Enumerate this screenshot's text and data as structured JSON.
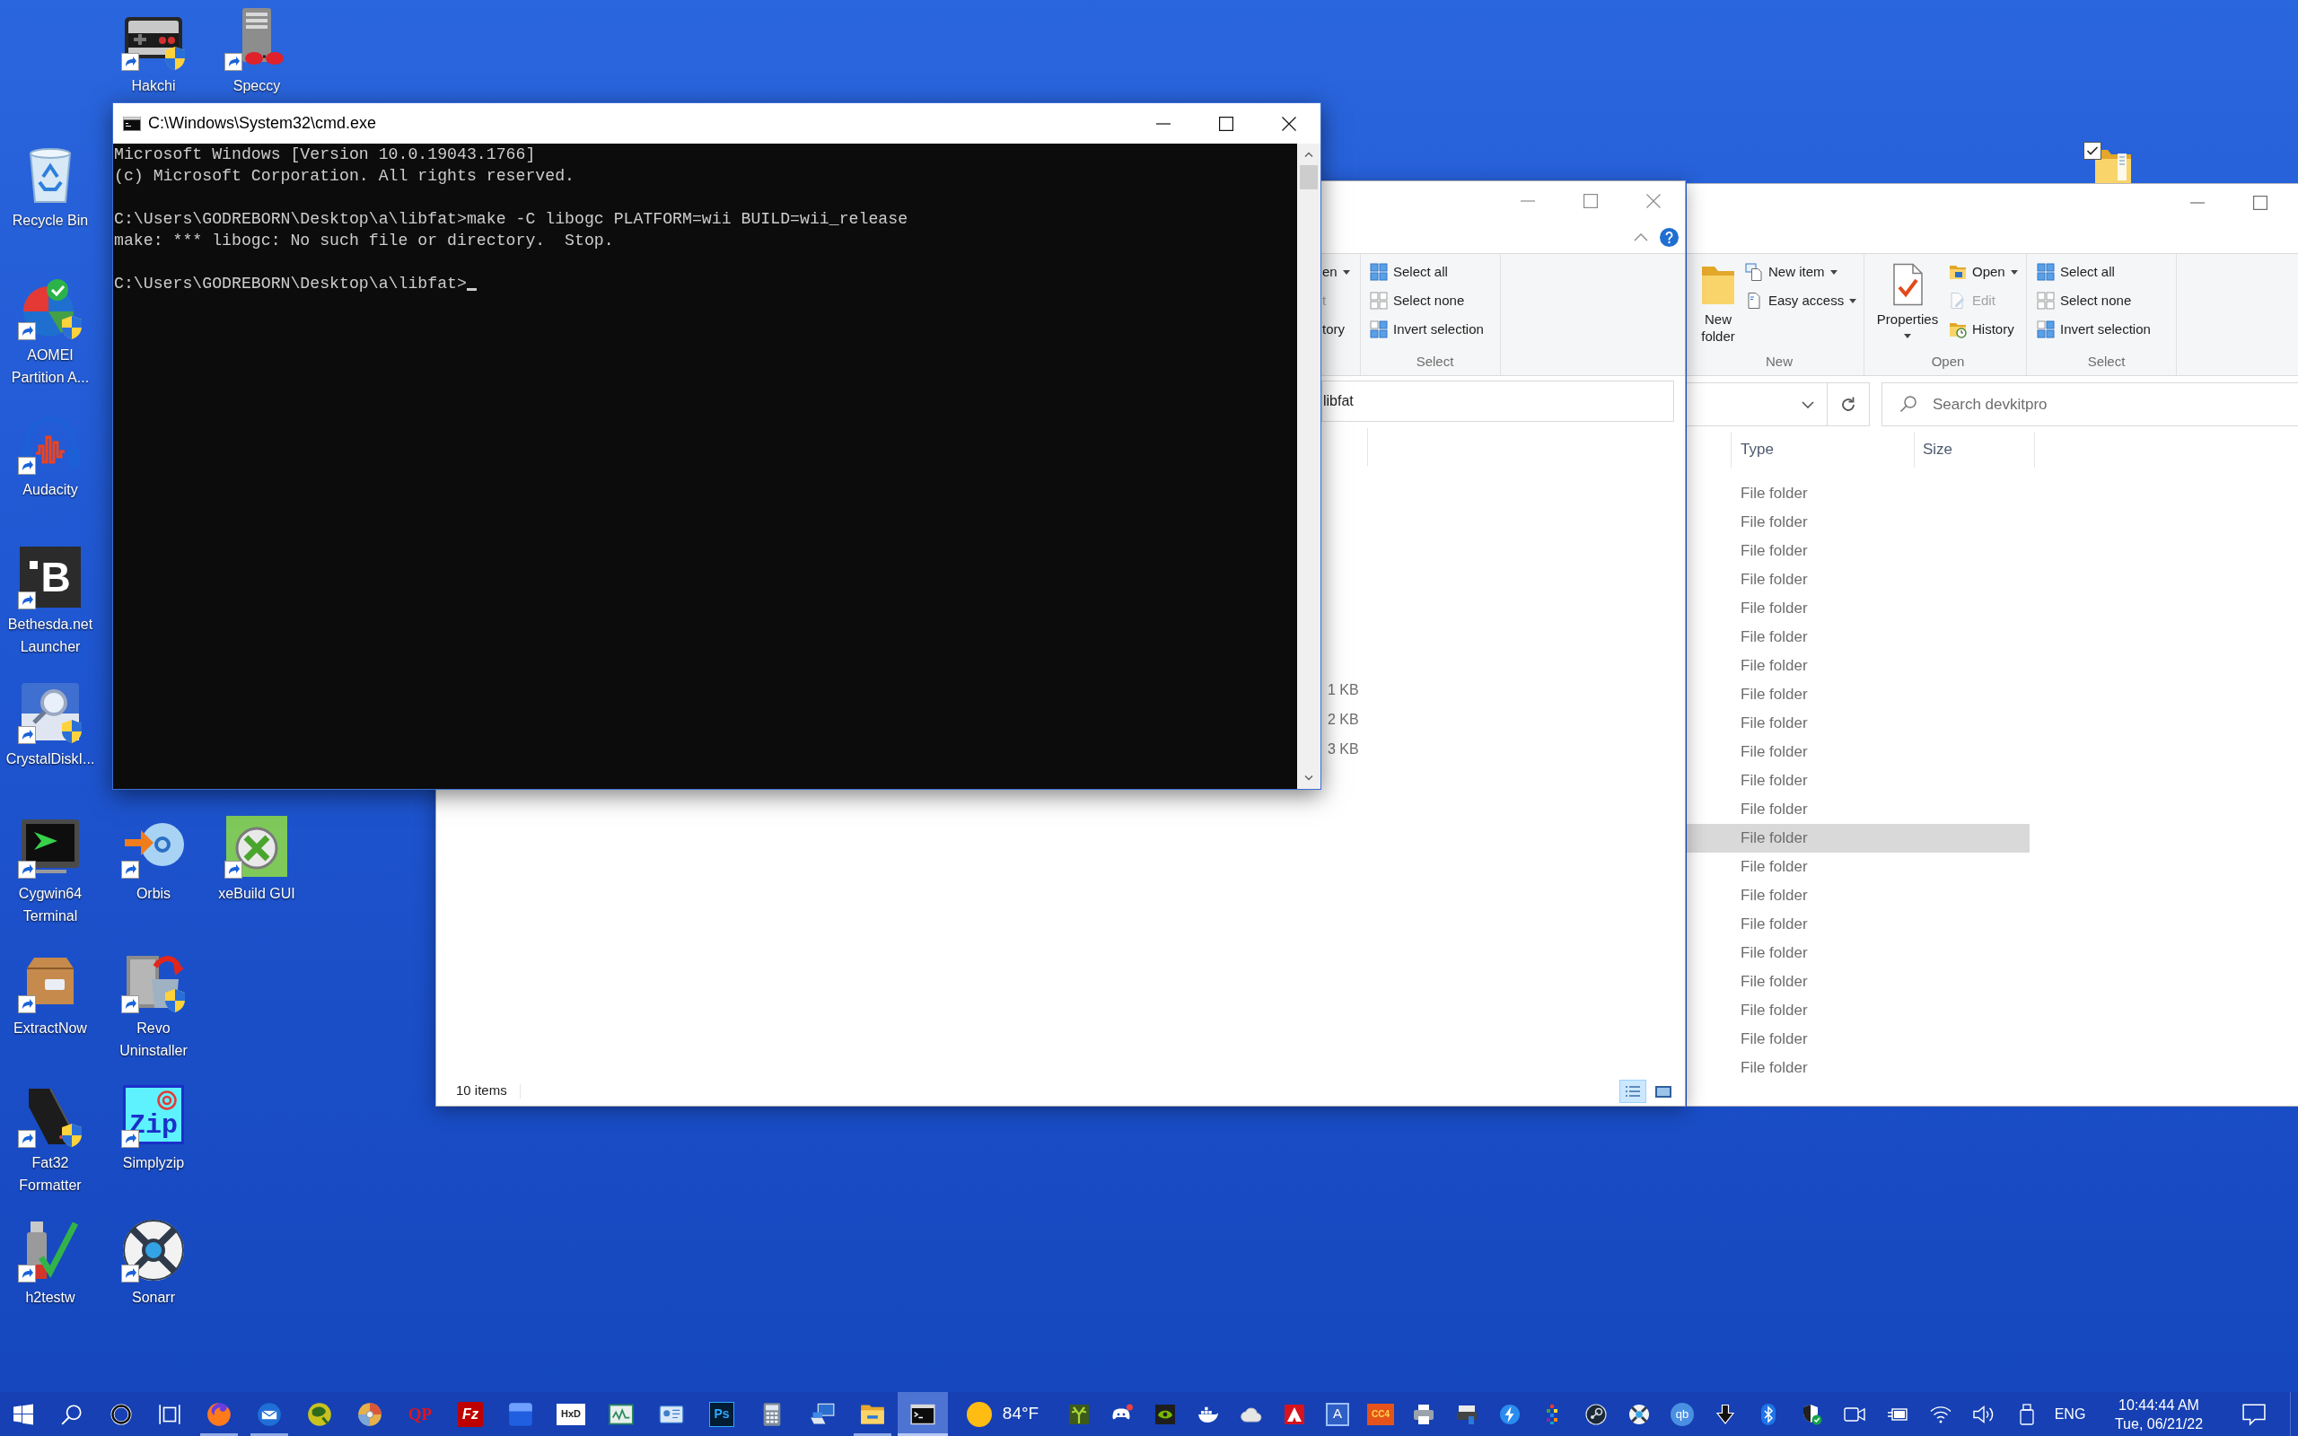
{
  "desktop": {
    "icons": [
      {
        "label": "Hakchi",
        "kind": "gamepad",
        "shortcut": true,
        "shield": true
      },
      {
        "label": "Speccy",
        "kind": "tower",
        "shortcut": true,
        "shield": false
      },
      {
        "label": "Recycle Bin",
        "kind": "bin",
        "shortcut": false,
        "shield": false
      },
      {
        "label": "AOMEI Partition A...",
        "kind": "pie",
        "shortcut": true,
        "shield": true
      },
      {
        "label": "Audacity",
        "kind": "headphones",
        "shortcut": true,
        "shield": false
      },
      {
        "label": "Bethesda.net Launcher",
        "kind": "letter-tile",
        "logo_text": "B",
        "shortcut": true,
        "shield": false
      },
      {
        "label": "CrystalDiskI...",
        "kind": "disk",
        "shortcut": true,
        "shield": true
      },
      {
        "label": "Cygwin64 Terminal",
        "kind": "terminal",
        "shortcut": true,
        "shield": false
      },
      {
        "label": "Orbis",
        "kind": "disc-arrow",
        "shortcut": true,
        "shield": false
      },
      {
        "label": "xeBuild GUI",
        "kind": "orb",
        "shortcut": true,
        "shield": false
      },
      {
        "label": "ExtractNow",
        "kind": "box",
        "shortcut": true,
        "shield": false
      },
      {
        "label": "Revo Uninstaller",
        "kind": "bin-arrow",
        "shortcut": true,
        "shield": true
      },
      {
        "label": "Fat32 Formatter",
        "kind": "drive",
        "shortcut": true,
        "shield": true
      },
      {
        "label": "Simplyzip",
        "kind": "zip-tile",
        "logo_text": "Zip",
        "shortcut": true,
        "shield": false
      },
      {
        "label": "h2testw",
        "kind": "usb-check",
        "shortcut": true,
        "shield": false
      },
      {
        "label": "Sonarr",
        "kind": "ring",
        "shortcut": true,
        "shield": false
      }
    ],
    "covered_folder": {
      "checked": true
    }
  },
  "right_window": {
    "title_buttons": [
      {
        "kind": "minimize"
      },
      {
        "kind": "maximize"
      }
    ],
    "ribbon": [
      {
        "label": "New",
        "items": [
          {
            "kind": "new-folder",
            "label": "New folder",
            "dropdown": false,
            "disabled": false
          },
          {
            "kind": "new-item",
            "label": "New item",
            "dropdown": true,
            "disabled": false
          },
          {
            "kind": "easy-access",
            "label": "Easy access",
            "dropdown": true,
            "disabled": false
          }
        ]
      },
      {
        "label": "Open",
        "items": [
          {
            "kind": "properties",
            "label": "Properties",
            "dropdown": true,
            "disabled": false
          },
          {
            "kind": "open",
            "label": "Open",
            "dropdown": true,
            "disabled": false
          },
          {
            "kind": "edit",
            "label": "Edit",
            "dropdown": false,
            "disabled": true
          },
          {
            "kind": "history",
            "label": "History",
            "dropdown": false,
            "disabled": false
          }
        ]
      },
      {
        "label": "Select",
        "items": [
          {
            "kind": "select-all",
            "label": "Select all",
            "dropdown": false,
            "disabled": false
          },
          {
            "kind": "select-none",
            "label": "Select none",
            "dropdown": false,
            "disabled": false
          },
          {
            "kind": "invert-selection",
            "label": "Invert selection",
            "dropdown": false,
            "disabled": false
          }
        ]
      }
    ],
    "search": {
      "placeholder": "Search devkitpro"
    },
    "columns": [
      "Type",
      "Size"
    ],
    "rows": [
      {
        "type": "File folder",
        "selected": false
      },
      {
        "type": "File folder",
        "selected": false
      },
      {
        "type": "File folder",
        "selected": false
      },
      {
        "type": "File folder",
        "selected": false
      },
      {
        "type": "File folder",
        "selected": false
      },
      {
        "type": "File folder",
        "selected": false
      },
      {
        "type": "File folder",
        "selected": false
      },
      {
        "type": "File folder",
        "selected": false
      },
      {
        "type": "File folder",
        "selected": false
      },
      {
        "type": "File folder",
        "selected": false
      },
      {
        "type": "File folder",
        "selected": false
      },
      {
        "type": "File folder",
        "selected": false
      },
      {
        "type": "File folder",
        "selected": true
      },
      {
        "type": "File folder",
        "selected": false
      },
      {
        "type": "File folder",
        "selected": false
      },
      {
        "type": "File folder",
        "selected": false
      },
      {
        "type": "File folder",
        "selected": false
      },
      {
        "type": "File folder",
        "selected": false
      },
      {
        "type": "File folder",
        "selected": false
      },
      {
        "type": "File folder",
        "selected": false
      },
      {
        "type": "File folder",
        "selected": false
      }
    ]
  },
  "middle_window": {
    "title_buttons": [
      {
        "kind": "minimize"
      },
      {
        "kind": "maximize"
      },
      {
        "kind": "close"
      }
    ],
    "ribbon": [
      {
        "items": [
          {
            "kind": "fragment",
            "label": "en",
            "dropdown": true,
            "disabled": false
          },
          {
            "kind": "fragment",
            "label": "t",
            "dropdown": false,
            "disabled": true
          },
          {
            "kind": "fragment",
            "label": "tory",
            "dropdown": false,
            "disabled": false
          }
        ]
      },
      {
        "label": "Select",
        "items": [
          {
            "kind": "select-all",
            "label": "Select all",
            "dropdown": false,
            "disabled": false
          },
          {
            "kind": "select-none",
            "label": "Select none",
            "dropdown": false,
            "disabled": false
          },
          {
            "kind": "invert-selection",
            "label": "Invert selection",
            "dropdown": false,
            "disabled": false
          }
        ]
      }
    ],
    "address": "libfat",
    "size_cells": [
      "1 KB",
      "2 KB",
      "3 KB"
    ],
    "status": "10 items",
    "view_buttons": [
      {
        "kind": "details",
        "selected": true
      },
      {
        "kind": "large-icons",
        "selected": false
      }
    ]
  },
  "console_window": {
    "title": "C:\\Windows\\System32\\cmd.exe",
    "title_buttons": [
      {
        "kind": "minimize"
      },
      {
        "kind": "maximize"
      },
      {
        "kind": "close"
      }
    ],
    "blocks": [
      [
        "Microsoft Windows [Version 10.0.19043.1766]",
        "(c) Microsoft Corporation. All rights reserved."
      ],
      [
        "C:\\Users\\GODREBORN\\Desktop\\a\\libfat>make -C libogc PLATFORM=wii BUILD=wii_release",
        "make: *** libogc: No such file or directory.  Stop."
      ],
      [
        "C:\\Users\\GODREBORN\\Desktop\\a\\libfat>"
      ]
    ],
    "cursor": true
  },
  "taskbar": {
    "buttons": [
      {
        "kind": "start"
      },
      {
        "kind": "search"
      },
      {
        "kind": "cortana"
      },
      {
        "kind": "task-view"
      }
    ],
    "apps": [
      {
        "kind": "globe",
        "running": true,
        "selected": false
      },
      {
        "kind": "mail",
        "running": true,
        "selected": false
      },
      {
        "kind": "sphere",
        "running": false,
        "selected": false
      },
      {
        "kind": "disc",
        "running": false,
        "selected": false
      },
      {
        "kind": "letters-red",
        "label": "QP",
        "running": false,
        "selected": false
      },
      {
        "kind": "tile-red",
        "label": "Fz",
        "running": false,
        "selected": false
      },
      {
        "kind": "window",
        "running": false,
        "selected": false
      },
      {
        "kind": "tile-white",
        "label": "HxD",
        "running": false,
        "selected": false
      },
      {
        "kind": "monitor",
        "running": false,
        "selected": false
      },
      {
        "kind": "card",
        "running": false,
        "selected": false
      },
      {
        "kind": "tile-navy",
        "label": "Ps",
        "running": false,
        "selected": false
      },
      {
        "kind": "calculator",
        "running": false,
        "selected": false
      },
      {
        "kind": "computer",
        "running": false,
        "selected": false
      },
      {
        "kind": "folder",
        "running": true,
        "selected": false
      },
      {
        "kind": "terminal",
        "running": true,
        "selected": true
      }
    ],
    "weather": {
      "temperature": "84°F"
    },
    "tray": [
      {
        "kind": "plant"
      },
      {
        "kind": "controller"
      },
      {
        "kind": "swirl"
      },
      {
        "kind": "whale"
      },
      {
        "kind": "cloud"
      },
      {
        "kind": "triangle"
      },
      {
        "kind": "tile-blue",
        "label": "A"
      },
      {
        "kind": "tile-orange",
        "label": "CC4"
      },
      {
        "kind": "printer"
      },
      {
        "kind": "scanner"
      },
      {
        "kind": "lightning"
      },
      {
        "kind": "dots"
      },
      {
        "kind": "knob"
      },
      {
        "kind": "lifebuoy"
      },
      {
        "kind": "circle-blue",
        "label": "qb"
      },
      {
        "kind": "download"
      },
      {
        "kind": "bluetooth"
      },
      {
        "kind": "shield"
      },
      {
        "kind": "webcam"
      },
      {
        "kind": "battery"
      },
      {
        "kind": "wifi"
      },
      {
        "kind": "volume"
      },
      {
        "kind": "usb"
      }
    ],
    "language": "ENG",
    "clock": {
      "time": "10:44:44 AM",
      "date": "Tue, 06/21/22"
    }
  }
}
